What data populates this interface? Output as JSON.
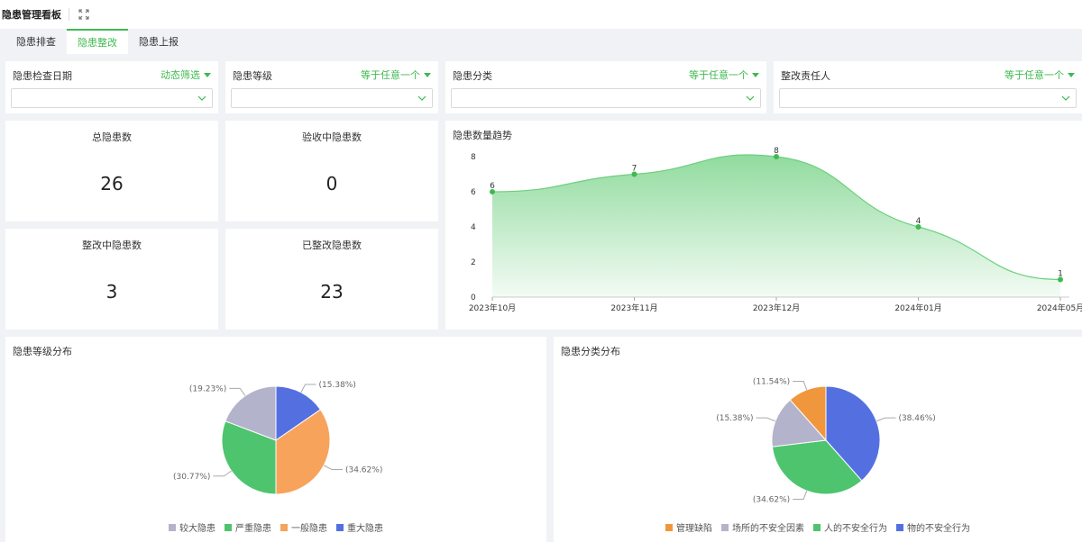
{
  "header": {
    "title": "隐患管理看板",
    "expand_icon": "expand-icon"
  },
  "tabs": [
    {
      "label": "隐患排查",
      "active": false
    },
    {
      "label": "隐患整改",
      "active": true
    },
    {
      "label": "隐患上报",
      "active": false
    }
  ],
  "filters": [
    {
      "label": "隐患检查日期",
      "mode": "动态筛选",
      "value": ""
    },
    {
      "label": "隐患等级",
      "mode": "等于任意一个",
      "value": ""
    },
    {
      "label": "隐患分类",
      "mode": "等于任意一个",
      "value": ""
    },
    {
      "label": "整改责任人",
      "mode": "等于任意一个",
      "value": ""
    }
  ],
  "kpis": [
    {
      "label": "总隐患数",
      "value": "26"
    },
    {
      "label": "验收中隐患数",
      "value": "0"
    },
    {
      "label": "整改中隐患数",
      "value": "3"
    },
    {
      "label": "已整改隐患数",
      "value": "23"
    }
  ],
  "colors": {
    "accent": "#3fb950",
    "line": "#6ccf7e"
  },
  "chart_data": [
    {
      "type": "area",
      "title": "隐患数量趋势",
      "categories": [
        "2023年10月",
        "2023年11月",
        "2023年12月",
        "2024年01月",
        "2024年05月"
      ],
      "values": [
        6,
        7,
        8,
        4,
        1
      ],
      "ylim": [
        0,
        8
      ],
      "yticks": [
        "0",
        "2",
        "4",
        "6",
        "8"
      ],
      "data_labels": true,
      "grid": false,
      "color": "#6ccf7e"
    },
    {
      "type": "pie",
      "title": "隐患等级分布",
      "slices": [
        {
          "name": "重大隐患",
          "value": 15.38,
          "label": "(15.38%)",
          "color": "#5470e0"
        },
        {
          "name": "一般隐患",
          "value": 34.62,
          "label": "(34.62%)",
          "color": "#f7a35c"
        },
        {
          "name": "严重隐患",
          "value": 30.77,
          "label": "(30.77%)",
          "color": "#4ec46e"
        },
        {
          "name": "较大隐患",
          "value": 19.23,
          "label": "(19.23%)",
          "color": "#b3b3cc"
        }
      ],
      "legend_order": [
        "较大隐患",
        "严重隐患",
        "一般隐患",
        "重大隐患"
      ],
      "legend_position": "bottom"
    },
    {
      "type": "pie",
      "title": "隐患分类分布",
      "slices": [
        {
          "name": "物的不安全行为",
          "value": 38.46,
          "label": "(38.46%)",
          "color": "#5470e0"
        },
        {
          "name": "人的不安全行为",
          "value": 34.62,
          "label": "(34.62%)",
          "color": "#4ec46e"
        },
        {
          "name": "场所的不安全因素",
          "value": 15.38,
          "label": "(15.38%)",
          "color": "#b3b3cc"
        },
        {
          "name": "管理缺陷",
          "value": 11.54,
          "label": "(11.54%)",
          "color": "#f0973e"
        }
      ],
      "legend_order": [
        "管理缺陷",
        "场所的不安全因素",
        "人的不安全行为",
        "物的不安全行为"
      ],
      "legend_position": "bottom"
    }
  ]
}
